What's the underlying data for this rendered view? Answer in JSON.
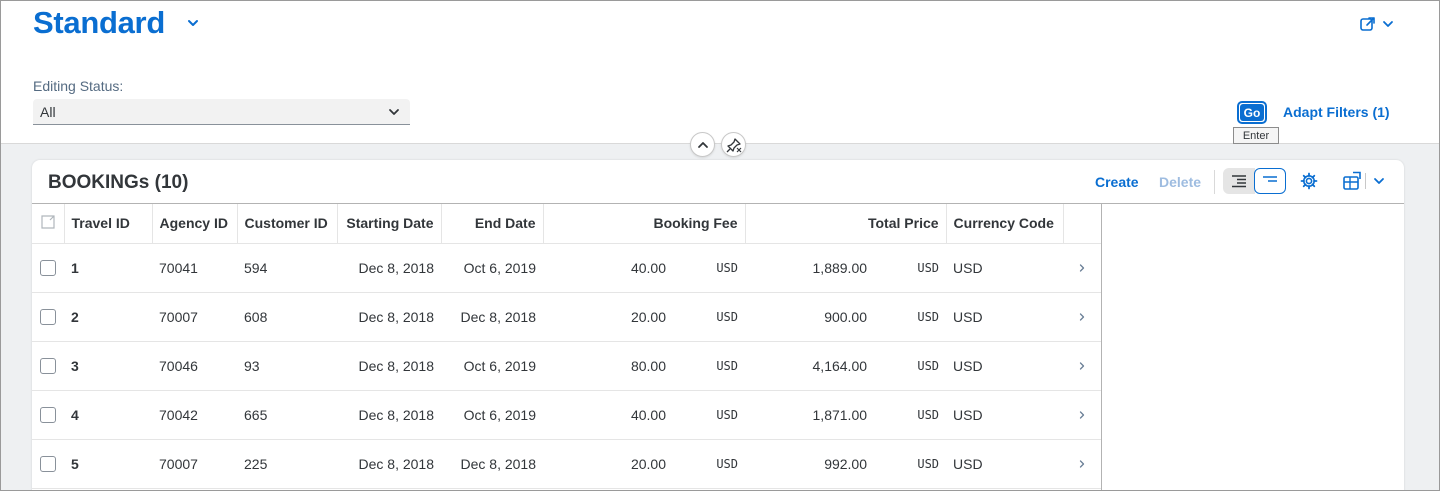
{
  "header": {
    "title": "Standard",
    "filter_label": "Editing Status:",
    "filter_value": "All",
    "go_label": "Go",
    "go_tooltip": "Enter",
    "adapt_filters": "Adapt Filters (1)"
  },
  "table": {
    "title": "BOOKINGs (10)",
    "create_label": "Create",
    "delete_label": "Delete",
    "columns": {
      "travel_id": "Travel ID",
      "agency_id": "Agency ID",
      "customer_id": "Customer ID",
      "starting_date": "Starting Date",
      "end_date": "End Date",
      "booking_fee": "Booking Fee",
      "total_price": "Total Price",
      "currency_code": "Currency Code"
    },
    "rows": [
      {
        "travel_id": "1",
        "agency_id": "70041",
        "customer_id": "594",
        "starting_date": "Dec 8, 2018",
        "end_date": "Oct 6, 2019",
        "booking_fee": "40.00",
        "fee_currency": "USD",
        "total_price": "1,889.00",
        "price_currency": "USD",
        "currency_code": "USD"
      },
      {
        "travel_id": "2",
        "agency_id": "70007",
        "customer_id": "608",
        "starting_date": "Dec 8, 2018",
        "end_date": "Dec 8, 2018",
        "booking_fee": "20.00",
        "fee_currency": "USD",
        "total_price": "900.00",
        "price_currency": "USD",
        "currency_code": "USD"
      },
      {
        "travel_id": "3",
        "agency_id": "70046",
        "customer_id": "93",
        "starting_date": "Dec 8, 2018",
        "end_date": "Oct 6, 2019",
        "booking_fee": "80.00",
        "fee_currency": "USD",
        "total_price": "4,164.00",
        "price_currency": "USD",
        "currency_code": "USD"
      },
      {
        "travel_id": "4",
        "agency_id": "70042",
        "customer_id": "665",
        "starting_date": "Dec 8, 2018",
        "end_date": "Oct 6, 2019",
        "booking_fee": "40.00",
        "fee_currency": "USD",
        "total_price": "1,871.00",
        "price_currency": "USD",
        "currency_code": "USD"
      },
      {
        "travel_id": "5",
        "agency_id": "70007",
        "customer_id": "225",
        "starting_date": "Dec 8, 2018",
        "end_date": "Dec 8, 2018",
        "booking_fee": "20.00",
        "fee_currency": "USD",
        "total_price": "992.00",
        "price_currency": "USD",
        "currency_code": "USD"
      }
    ]
  },
  "icons": {
    "title_dropdown": "chevron-down-icon",
    "share": "share-icon",
    "select_dropdown": "chevron-down-icon",
    "collapse_header": "chevron-up-icon",
    "pin_header": "pin-icon",
    "table_settings": "gear-icon",
    "export": "export-spreadsheet-icon",
    "row_navigation": "chevron-right-icon"
  },
  "colors": {
    "accent": "#0a6ed1",
    "disabled_action": "#9ebce0",
    "content_background": "#eef0f2"
  }
}
